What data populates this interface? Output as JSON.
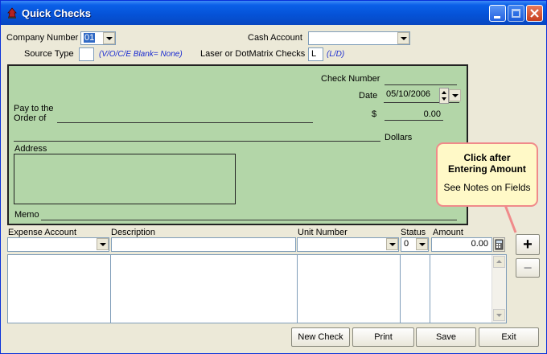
{
  "window": {
    "title": "Quick Checks"
  },
  "header": {
    "company_number_label": "Company Number",
    "company_number_value": "01",
    "cash_account_label": "Cash Account",
    "cash_account_value": "",
    "source_type_label": "Source Type",
    "source_type_value": "",
    "source_type_hint": "(V/O/C/E Blank= None)",
    "laser_label": "Laser or DotMatrix Checks",
    "laser_value": "L",
    "laser_hint": "(L/D)"
  },
  "check": {
    "check_number_label": "Check Number",
    "check_number_value": "",
    "date_label": "Date",
    "date_value": "05/10/2006",
    "dollar_label": "$",
    "amount_value": "0.00",
    "pay_to_label_1": "Pay to the",
    "pay_to_label_2": "Order of",
    "dollars_label": "Dollars",
    "address_label": "Address",
    "memo_label": "Memo"
  },
  "callout": {
    "line1": "Click after",
    "line2": "Entering Amount",
    "line3": "See Notes on Fields"
  },
  "entry": {
    "columns": [
      "Expense Account",
      "Description",
      "Unit Number",
      "Status",
      "Amount"
    ],
    "status_value": "0",
    "amount_value": "0.00"
  },
  "buttons": {
    "add_symbol": "+",
    "remove_symbol": "−",
    "new_check": "New Check",
    "print": "Print",
    "save": "Save",
    "exit": "Exit"
  },
  "colors": {
    "check_bg": "#b3d6a8",
    "title_bar": "#0552d6",
    "callout_border": "#f08a8a",
    "hint_text": "#1a2bd0"
  }
}
